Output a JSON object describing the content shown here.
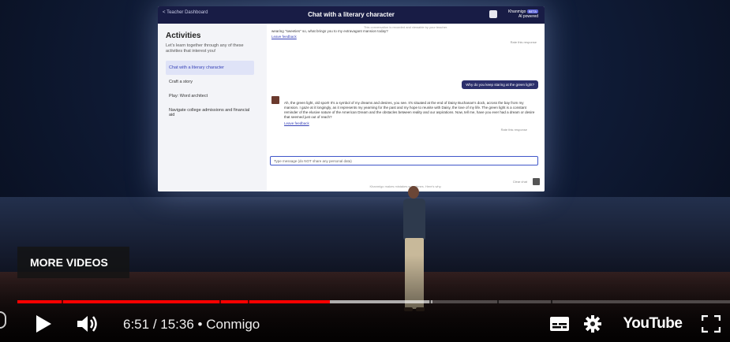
{
  "screen": {
    "back_label": "< Teacher Dashboard",
    "title": "Chat with a literary character",
    "brand": "Khanmigo",
    "brand_badge": "BETA",
    "brand_sub": "Al powered",
    "activities_title": "Activities",
    "activities_desc": "Let's learn together through any of these activities that interest you!",
    "activities": [
      "Chat with a literary character",
      "Craft a story",
      "Play: Word architect",
      "Navigate college admissions and financial aid"
    ],
    "top_note": "This conversation is recorded and viewable by your teacher.",
    "top_line": "wearing \"sweeties\" so, what brings you to my extravagant mansion today?",
    "leave_feedback": "Leave feedback",
    "rate_label": "Rate this response",
    "user_message": "Why do you keep staring at the green light?",
    "bot_message": "Ah, the green light, old sport! It's a symbol of my dreams and desires, you see. It's situated at the end of Daisy Buchanan's dock, across the bay from my mansion. I gaze at it longingly, as it represents my yearning for the past and my hope to reunite with Daisy, the love of my life. The green light is a constant reminder of the elusive nature of the American Dream and the obstacles between reality and our aspirations. Now, tell me, have you ever had a dream or desire that seemed just out of reach?",
    "input_placeholder": "Type message (do NOT share any personal data)",
    "clear_chat": "Clear chat",
    "footer_note": "Khanmigo makes mistakes sometimes. Here's why."
  },
  "overlay": {
    "more_videos": "MORE VIDEOS"
  },
  "player": {
    "current_time": "6:51",
    "duration": "15:36",
    "chapter": "Conmigo",
    "separator": " / ",
    "dot": " • ",
    "played_fraction": 0.439,
    "loaded_fraction": 0.582,
    "youtube_logo": "YouTube",
    "accent_color": "#ff0000"
  }
}
